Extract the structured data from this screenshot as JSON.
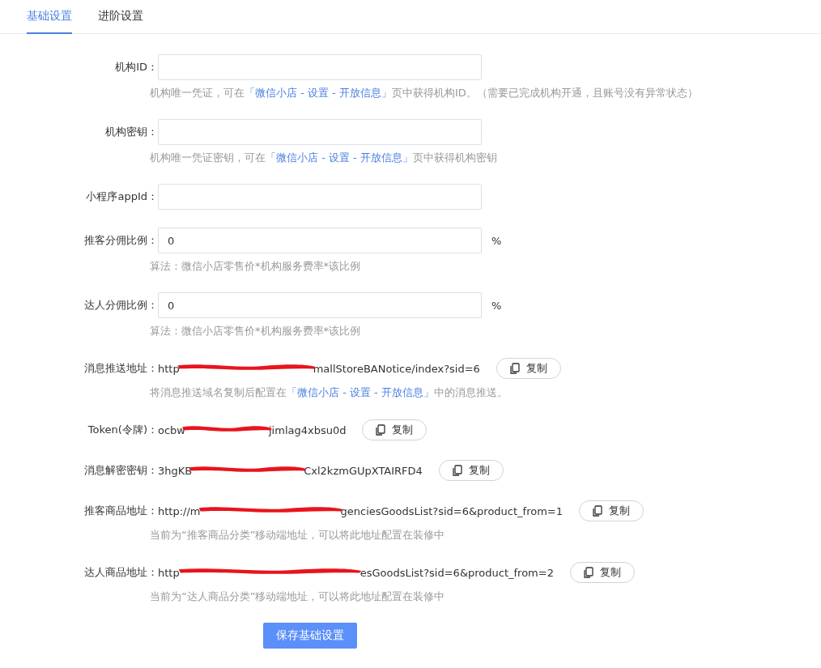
{
  "tabs": [
    {
      "label": "基础设置",
      "selected": true
    },
    {
      "label": "进阶设置",
      "selected": false
    }
  ],
  "fields": [
    {
      "kind": "input",
      "label": "机构ID：",
      "hint": {
        "before": "机构唯一凭证，可在",
        "link": "「微信小店 - 设置 - 开放信息」",
        "after": "页中获得机构ID。（需要已完成机构开通，且账号没有异常状态）"
      }
    },
    {
      "kind": "input",
      "label": "机构密钥：",
      "hint": {
        "before": "机构唯一凭证密钥，可在",
        "link": "「微信小店 - 设置 - 开放信息」",
        "after": "页中获得机构密钥"
      }
    },
    {
      "kind": "input",
      "label": "小程序appId："
    },
    {
      "kind": "percent",
      "label": "推客分佣比例：",
      "value": "0",
      "unit": "%",
      "hint": {
        "before": "算法：微信小店零售价*机构服务费率*该比例"
      }
    },
    {
      "kind": "percent",
      "label": "达人分佣比例：",
      "value": "0",
      "unit": "%",
      "hint": {
        "before": "算法：微信小店零售价*机构服务费率*该比例"
      }
    },
    {
      "kind": "copy",
      "label": "消息推送地址：",
      "value_start": "http",
      "value_end": "mallStoreBANotice/index?sid=6",
      "button": "复制",
      "hint": {
        "before": "将消息推送域名复制后配置在",
        "link": "「微信小店 - 设置 - 开放信息」",
        "after": "中的消息推送。"
      }
    },
    {
      "kind": "copy",
      "label": "Token(令牌)：",
      "value_start": "ocbw",
      "value_end": "jimlag4xbsu0d",
      "button": "复制"
    },
    {
      "kind": "copy",
      "label": "消息解密密钥：",
      "value_start": "3hgKB",
      "value_end": "Cxl2kzmGUpXTAIRFD4",
      "button": "复制"
    },
    {
      "kind": "copy",
      "label": "推客商品地址：",
      "value_start": "http://m",
      "value_end": "genciesGoodsList?sid=6&product_from=1",
      "button": "复制",
      "hint": {
        "before": "当前为“推客商品分类”移动端地址，可以将此地址配置在装修中"
      }
    },
    {
      "kind": "copy",
      "label": "达人商品地址：",
      "value_start": "http",
      "value_end": "esGoodsList?sid=6&product_from=2",
      "button": "复制",
      "hint": {
        "before": "当前为“达人商品分类”移动端地址，可以将此地址配置在装修中"
      }
    }
  ],
  "save_button": "保存基础设置"
}
